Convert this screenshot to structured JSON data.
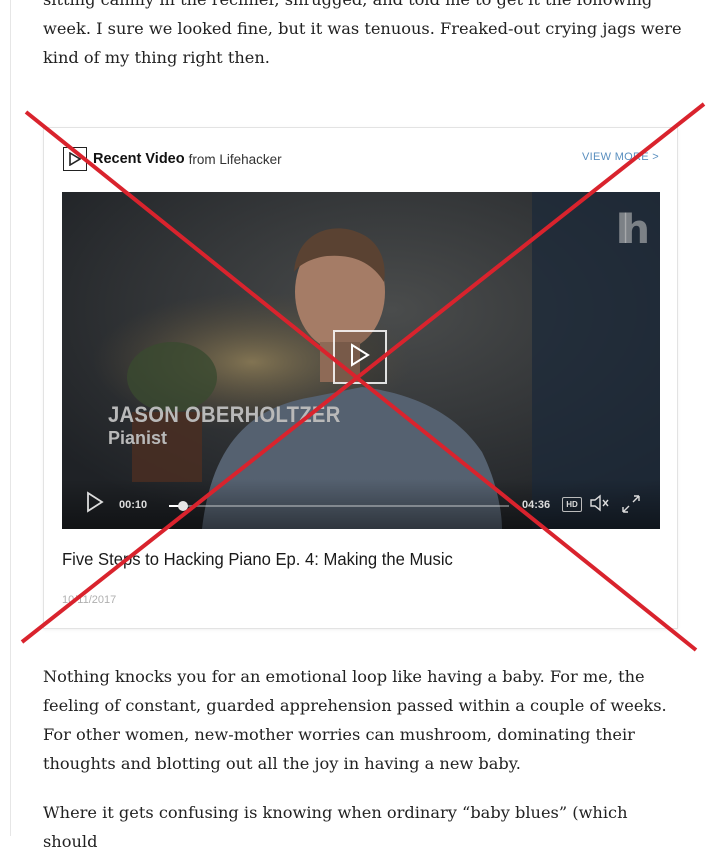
{
  "article": {
    "paragraph_top": "sitting calmly in the recliner, shrugged, and told me to get it the following week. I sure we looked fine, but it was tenuous. Freaked-out crying jags were kind of my thing right then.",
    "paragraph_mid": "Nothing knocks you for an emotional loop like having a baby. For me, the feeling of constant, guarded apprehension passed within a couple of weeks. For other women, new-mother worries can mushroom, dominating their thoughts and blotting out all the joy in having a new baby.",
    "paragraph_bottom": "Where it gets confusing is knowing when ordinary “baby blues” (which should"
  },
  "video_card": {
    "header_title": "Recent Video",
    "header_from": "from Lifehacker",
    "view_more": "VIEW MORE >",
    "player": {
      "overlay_name": "JASON OBERHOLTZER",
      "overlay_role": "Pianist",
      "logo": "lh",
      "current_time": "00:10",
      "total_time": "04:36",
      "hd_label": "HD",
      "progress_fraction": 0.04
    },
    "video_title": "Five Steps to Hacking Piano Ep. 4: Making the Music",
    "date": "10/11/2017"
  },
  "icons": {
    "header_icon": "play-square-icon",
    "big_play": "play-icon",
    "volume": "volume-muted-icon",
    "fullscreen": "fullscreen-icon"
  },
  "colors": {
    "cross_red": "#d9232d",
    "link_blue": "#5a8fbf"
  }
}
